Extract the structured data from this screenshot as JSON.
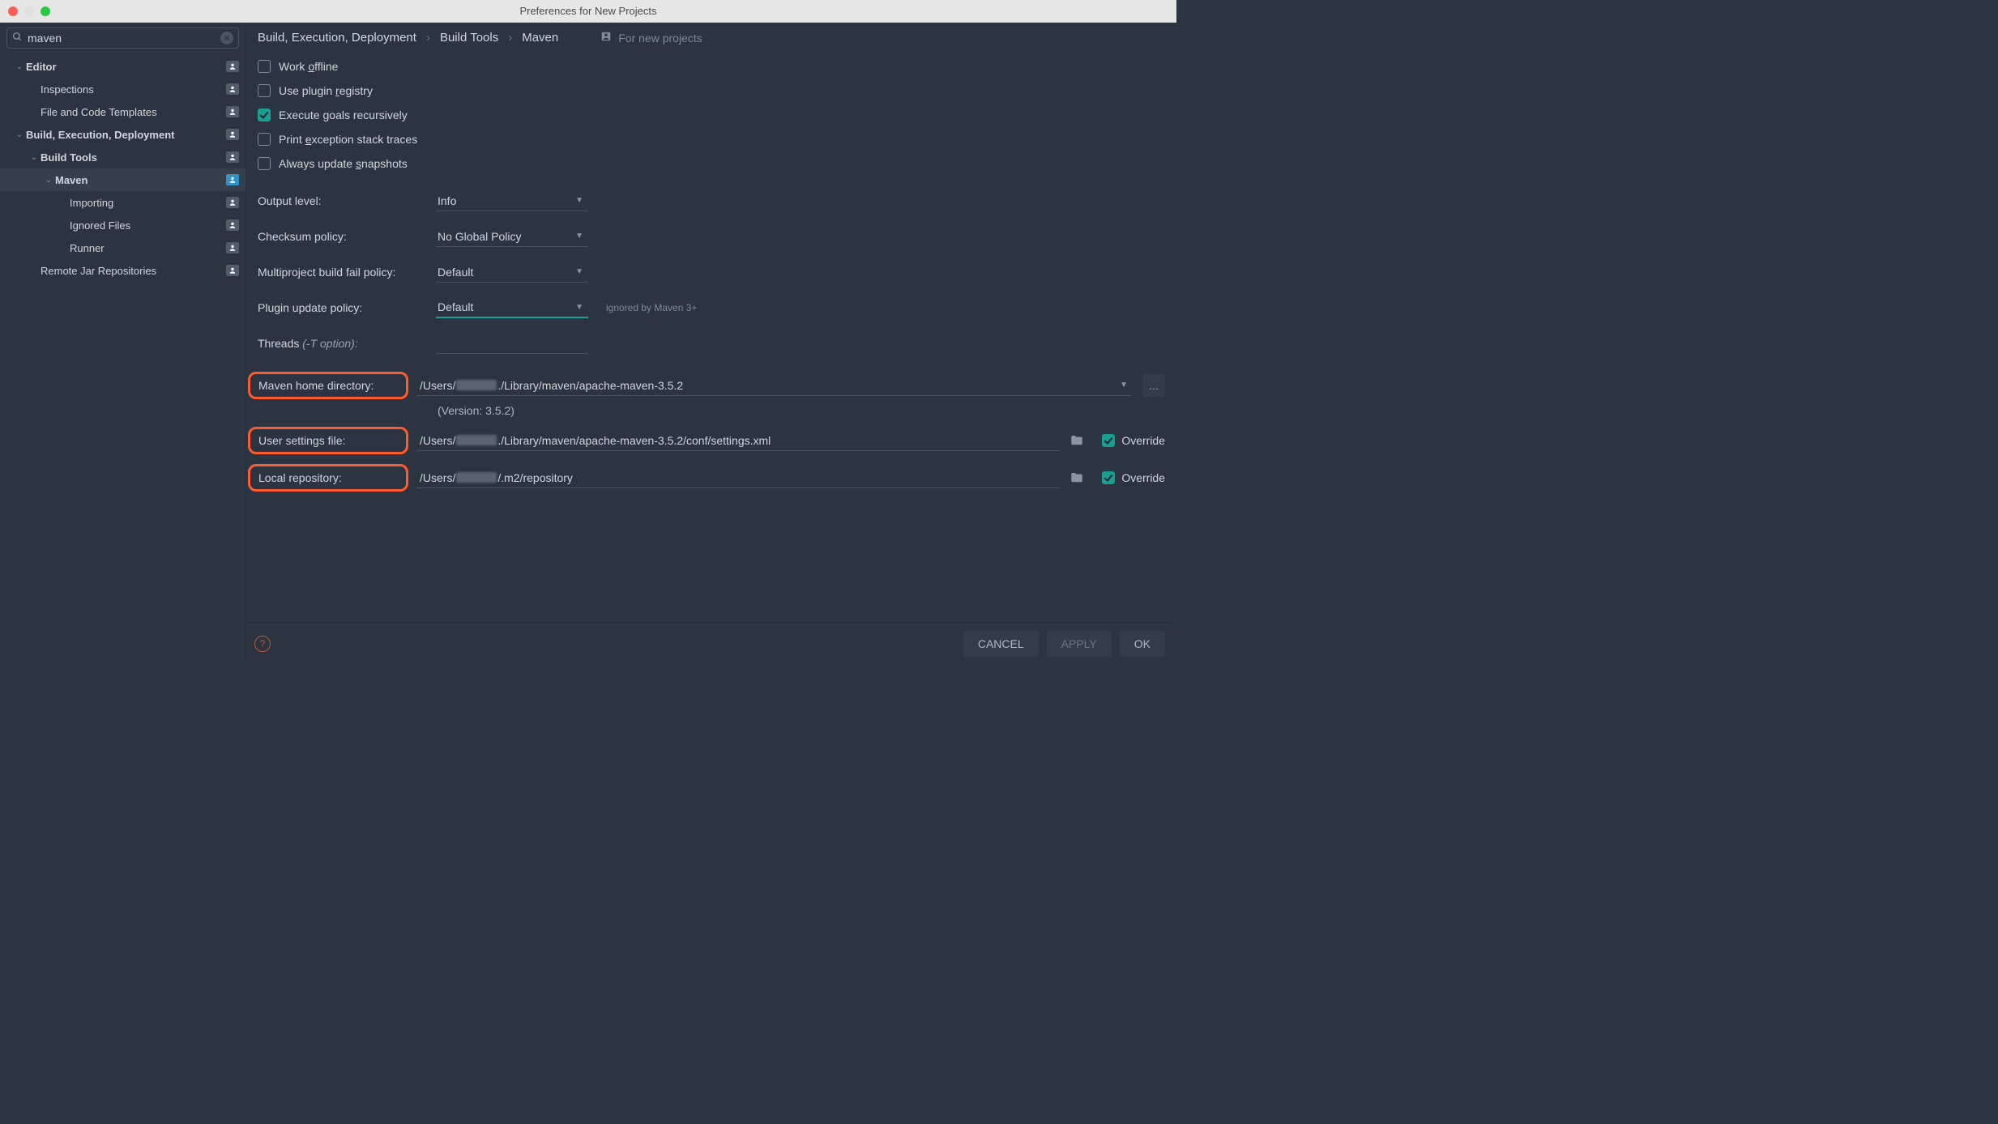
{
  "window": {
    "title": "Preferences for New Projects"
  },
  "search": {
    "value": "maven"
  },
  "sidebar": [
    {
      "label": "Editor",
      "indent": 0,
      "bold": true,
      "chev": "down",
      "badge": true
    },
    {
      "label": "Inspections",
      "indent": 1,
      "bold": false,
      "chev": "",
      "badge": true
    },
    {
      "label": "File and Code Templates",
      "indent": 1,
      "bold": false,
      "chev": "",
      "badge": true
    },
    {
      "label": "Build, Execution, Deployment",
      "indent": 0,
      "bold": true,
      "chev": "down",
      "badge": true
    },
    {
      "label": "Build Tools",
      "indent": 1,
      "bold": true,
      "chev": "down",
      "badge": true
    },
    {
      "label": "Maven",
      "indent": 2,
      "bold": true,
      "chev": "down",
      "badge": true,
      "selected": true
    },
    {
      "label": "Importing",
      "indent": 3,
      "bold": false,
      "chev": "",
      "badge": true
    },
    {
      "label": "Ignored Files",
      "indent": 3,
      "bold": false,
      "chev": "",
      "badge": true
    },
    {
      "label": "Runner",
      "indent": 3,
      "bold": false,
      "chev": "",
      "badge": true
    },
    {
      "label": "Remote Jar Repositories",
      "indent": 1,
      "bold": false,
      "chev": "",
      "badge": true
    }
  ],
  "breadcrumbs": {
    "part1": "Build, Execution, Deployment",
    "part2": "Build Tools",
    "part3": "Maven",
    "scope": "For new projects"
  },
  "checkboxes": {
    "work_offline": {
      "label_pre": "Work ",
      "mn": "o",
      "label_post": "ffline",
      "checked": false
    },
    "plugin_registry": {
      "label_pre": "Use plugin ",
      "mn": "r",
      "label_post": "egistry",
      "checked": false
    },
    "exec_recursive": {
      "label_pre": "Execute ",
      "mn": "g",
      "label_post": "oals recursively",
      "checked": true
    },
    "print_stack": {
      "label_pre": "Print ",
      "mn": "e",
      "label_post": "xception stack traces",
      "checked": false
    },
    "update_snapshots": {
      "label_pre": "Always update ",
      "mn": "s",
      "label_post": "napshots",
      "checked": false
    }
  },
  "selects": {
    "output_level": {
      "label": "Output level:",
      "value": "Info"
    },
    "checksum_policy": {
      "label": "Checksum policy:",
      "value": "No Global Policy"
    },
    "multi_fail": {
      "label": "Multiproject build fail policy:",
      "value": "Default"
    },
    "plugin_update": {
      "label": "Plugin update policy:",
      "value": "Default",
      "hint": "ignored by Maven 3+"
    }
  },
  "threads": {
    "label": "Threads ",
    "opt": "(-T option):",
    "value": ""
  },
  "paths": {
    "maven_home": {
      "label": "Maven home directory:",
      "pre": "/Users/",
      "post": "./Library/maven/apache-maven-3.5.2",
      "version": "(Version: 3.5.2)"
    },
    "user_settings": {
      "label": "User settings file:",
      "pre": "/Users/",
      "post": "./Library/maven/apache-maven-3.5.2/conf/settings.xml",
      "override_label": "Override",
      "override_checked": true
    },
    "local_repo": {
      "label": "Local repository:",
      "pre": "/Users/",
      "post": "/.m2/repository",
      "override_label": "Override",
      "override_checked": true
    }
  },
  "buttons": {
    "cancel": "CANCEL",
    "apply": "APPLY",
    "ok": "OK"
  }
}
